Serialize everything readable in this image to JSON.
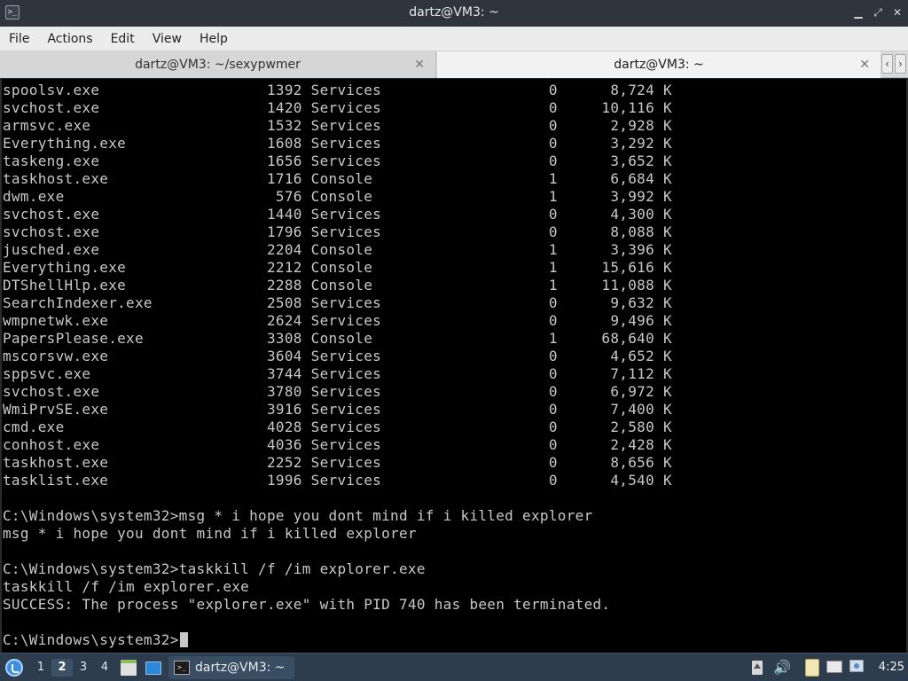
{
  "window": {
    "title": "dartz@VM3: ~",
    "app_icon_glyph": ">_",
    "controls": {
      "minimize": "▁",
      "maximize": "⤢",
      "close": "✕"
    }
  },
  "menu": [
    "File",
    "Actions",
    "Edit",
    "View",
    "Help"
  ],
  "tabs": [
    {
      "label": "dartz@VM3: ~/sexypwmer",
      "active": false,
      "close": "✕"
    },
    {
      "label": "dartz@VM3: ~",
      "active": true,
      "close": "✕"
    }
  ],
  "tab_scroll": {
    "left": "‹",
    "right": "›"
  },
  "terminal": {
    "lines": [
      "spoolsv.exe                   1392 Services                   0      8,724 K",
      "svchost.exe                   1420 Services                   0     10,116 K",
      "armsvc.exe                    1532 Services                   0      2,928 K",
      "Everything.exe                1608 Services                   0      3,292 K",
      "taskeng.exe                   1656 Services                   0      3,652 K",
      "taskhost.exe                  1716 Console                    1      6,684 K",
      "dwm.exe                        576 Console                    1      3,992 K",
      "svchost.exe                   1440 Services                   0      4,300 K",
      "svchost.exe                   1796 Services                   0      8,088 K",
      "jusched.exe                   2204 Console                    1      3,396 K",
      "Everything.exe                2212 Console                    1     15,616 K",
      "DTShellHlp.exe                2288 Console                    1     11,088 K",
      "SearchIndexer.exe             2508 Services                   0      9,632 K",
      "wmpnetwk.exe                  2624 Services                   0      9,496 K",
      "PapersPlease.exe              3308 Console                    1     68,640 K",
      "mscorsvw.exe                  3604 Services                   0      4,652 K",
      "sppsvc.exe                    3744 Services                   0      7,112 K",
      "svchost.exe                   3780 Services                   0      6,972 K",
      "WmiPrvSE.exe                  3916 Services                   0      7,400 K",
      "cmd.exe                       4028 Services                   0      2,580 K",
      "conhost.exe                   4036 Services                   0      2,428 K",
      "taskhost.exe                  2252 Services                   0      8,656 K",
      "tasklist.exe                  1996 Services                   0      4,540 K",
      "",
      "C:\\Windows\\system32>msg * i hope you dont mind if i killed explorer",
      "msg * i hope you dont mind if i killed explorer",
      "",
      "C:\\Windows\\system32>taskkill /f /im explorer.exe",
      "taskkill /f /im explorer.exe",
      "SUCCESS: The process \"explorer.exe\" with PID 740 has been terminated.",
      "",
      "C:\\Windows\\system32>"
    ]
  },
  "taskbar": {
    "workspaces": [
      "1",
      "2",
      "3",
      "4"
    ],
    "active_workspace": "2",
    "task_label": "dartz@VM3: ~",
    "task_icon_glyph": ">_",
    "volume_glyph": "🔊",
    "clock": "4:25"
  }
}
